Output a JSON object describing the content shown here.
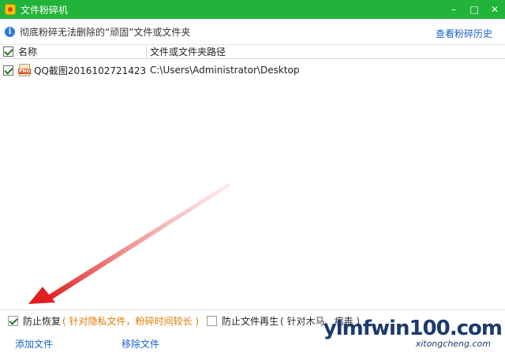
{
  "window": {
    "title": "文件粉碎机",
    "minimize_glyph": "–",
    "restore_glyph": "□",
    "close_glyph": "✕"
  },
  "infobar": {
    "icon_glyph": "i",
    "message": "彻底粉碎无法删除的“顽固”文件或文件夹",
    "history_link": "查看粉碎历史"
  },
  "table": {
    "columns": [
      "名称",
      "文件或文件夹路径"
    ],
    "rows": [
      {
        "name": "QQ截图20161027214230...",
        "path": "C:\\Users\\Administrator\\Desktop",
        "checked": true
      }
    ]
  },
  "options": {
    "prevent_recover": {
      "label": "防止恢复",
      "hint": "( 针对隐私文件，粉碎时间较长 )",
      "checked": true
    },
    "prevent_regen": {
      "label": "防止文件再生",
      "hint": "( 针对木马、病毒 )",
      "checked": false
    }
  },
  "footer": {
    "add_file": "添加文件",
    "remove_file": "移除文件"
  },
  "watermark": {
    "main": "ylmfwin100.com",
    "sub": "xitongcheng.com"
  },
  "colors": {
    "titlebar": "#22b33a",
    "link": "#1a63c6",
    "hint_orange": "#e07a00",
    "arrow": "#e02020"
  }
}
